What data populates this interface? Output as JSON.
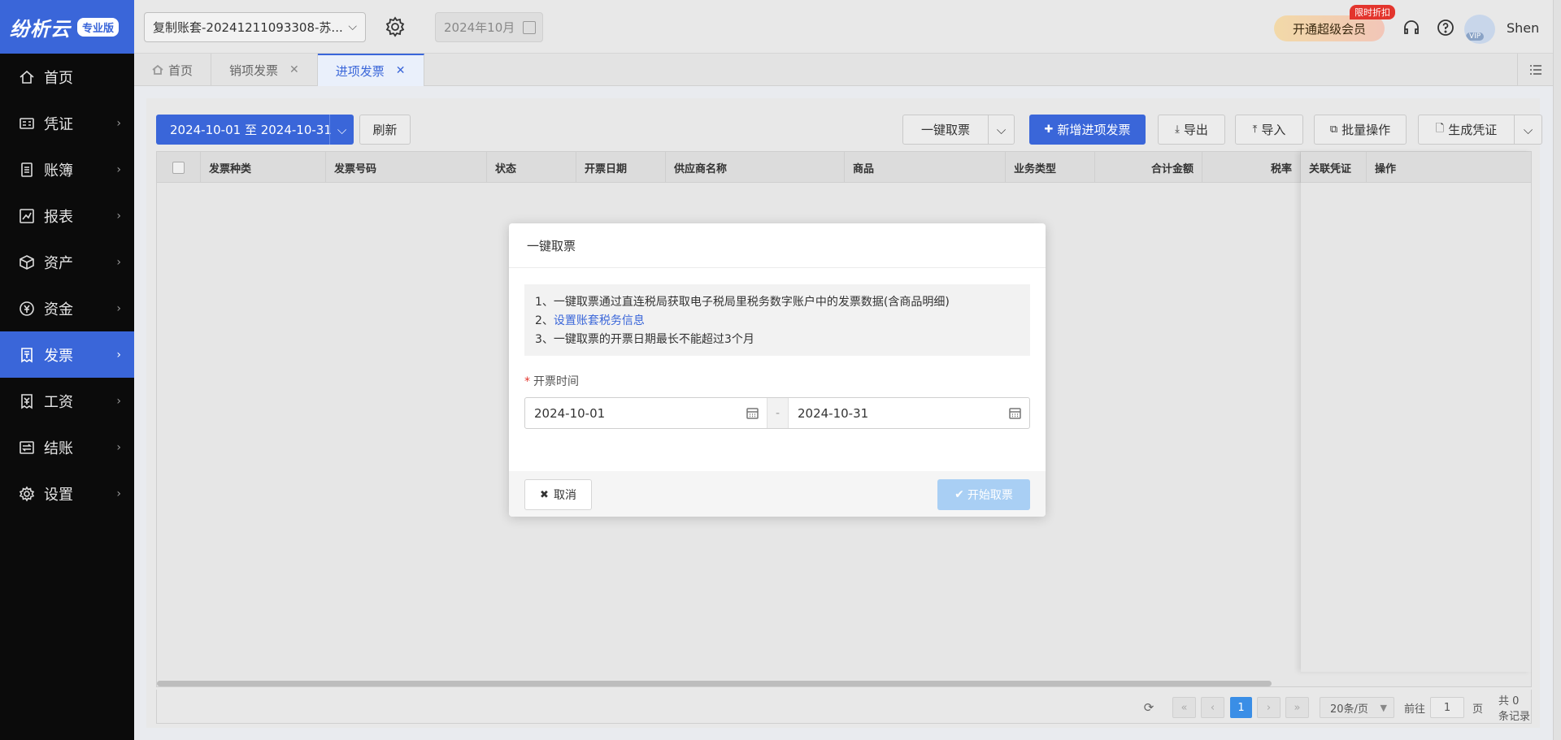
{
  "brand": {
    "logo_text": "纷析云",
    "edition": "专业版",
    "accent": "#3a66d9"
  },
  "sidebar": {
    "items": [
      {
        "label": "首页",
        "icon": "home-icon",
        "active": false
      },
      {
        "label": "凭证",
        "icon": "voucher-icon",
        "active": false
      },
      {
        "label": "账簿",
        "icon": "ledger-icon",
        "active": false
      },
      {
        "label": "报表",
        "icon": "report-icon",
        "active": false
      },
      {
        "label": "资产",
        "icon": "asset-icon",
        "active": false
      },
      {
        "label": "资金",
        "icon": "fund-icon",
        "active": false
      },
      {
        "label": "发票",
        "icon": "invoice-icon",
        "active": true
      },
      {
        "label": "工资",
        "icon": "salary-icon",
        "active": false
      },
      {
        "label": "结账",
        "icon": "closing-icon",
        "active": false
      },
      {
        "label": "设置",
        "icon": "settings-icon",
        "active": false
      }
    ]
  },
  "header": {
    "account": "复制账套-20241211093308-苏...",
    "period": "2024年10月",
    "vip_button": "开通超级会员",
    "promo_badge": "限时折扣",
    "avatar_badge": "VIP",
    "user": "Shen"
  },
  "tabs": [
    {
      "label": "首页",
      "closable": false,
      "active": false
    },
    {
      "label": "销项发票",
      "closable": true,
      "active": false
    },
    {
      "label": "进项发票",
      "closable": true,
      "active": true
    }
  ],
  "toolbar": {
    "date_range": "2024-10-01 至 2024-10-31",
    "refresh": "刷新",
    "fetch": "一键取票",
    "add": "新增进项发票",
    "export": "导出",
    "import": "导入",
    "batch": "批量操作",
    "voucher": "生成凭证"
  },
  "table": {
    "columns": [
      "发票种类",
      "发票号码",
      "状态",
      "开票日期",
      "供应商名称",
      "商品",
      "业务类型",
      "合计金额",
      "税率",
      "关联凭证",
      "操作"
    ],
    "rows": []
  },
  "pager": {
    "current_page": "1",
    "page_size": "20条/页",
    "goto_prefix": "前往",
    "goto_value": "1",
    "goto_suffix": "页",
    "total": "共 0 条记录"
  },
  "modal": {
    "title": "一键取票",
    "notice_1": "1、一键取票通过直连税局获取电子税局里税务数字账户中的发票数据(含商品明细)",
    "notice_2_prefix": "2、",
    "notice_2_link": "设置账套税务信息",
    "notice_3": "3、一键取票的开票日期最长不能超过3个月",
    "field_label": "开票时间",
    "start_date": "2024-10-01",
    "separator": "-",
    "end_date": "2024-10-31",
    "cancel": "取消",
    "start": "开始取票"
  }
}
